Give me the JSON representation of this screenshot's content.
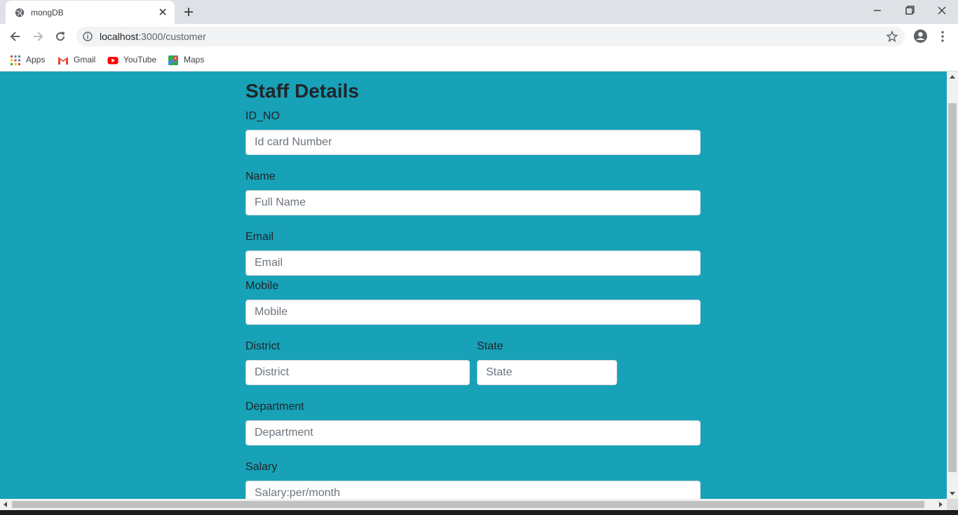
{
  "browser": {
    "tab_title": "mongDB",
    "url_host": "localhost",
    "url_path": ":3000/customer",
    "bookmarks": [
      {
        "label": "Apps",
        "icon": "apps-grid-icon"
      },
      {
        "label": "Gmail",
        "icon": "gmail-icon"
      },
      {
        "label": "YouTube",
        "icon": "youtube-icon"
      },
      {
        "label": "Maps",
        "icon": "maps-icon"
      }
    ]
  },
  "form": {
    "title": "Staff Details",
    "fields": {
      "id_no": {
        "label": "ID_NO",
        "placeholder": "Id card Number"
      },
      "name": {
        "label": "Name",
        "placeholder": "Full Name"
      },
      "email": {
        "label": "Email",
        "placeholder": "Email"
      },
      "mobile": {
        "label": "Mobile",
        "placeholder": "Mobile"
      },
      "district": {
        "label": "District",
        "placeholder": "District"
      },
      "state": {
        "label": "State",
        "placeholder": "State"
      },
      "department": {
        "label": "Department",
        "placeholder": "Department"
      },
      "salary": {
        "label": "Salary",
        "placeholder": "Salary:per/month"
      }
    }
  },
  "colors": {
    "page_background": "#17a2b8",
    "input_background": "#ffffff",
    "text": "#212529"
  }
}
